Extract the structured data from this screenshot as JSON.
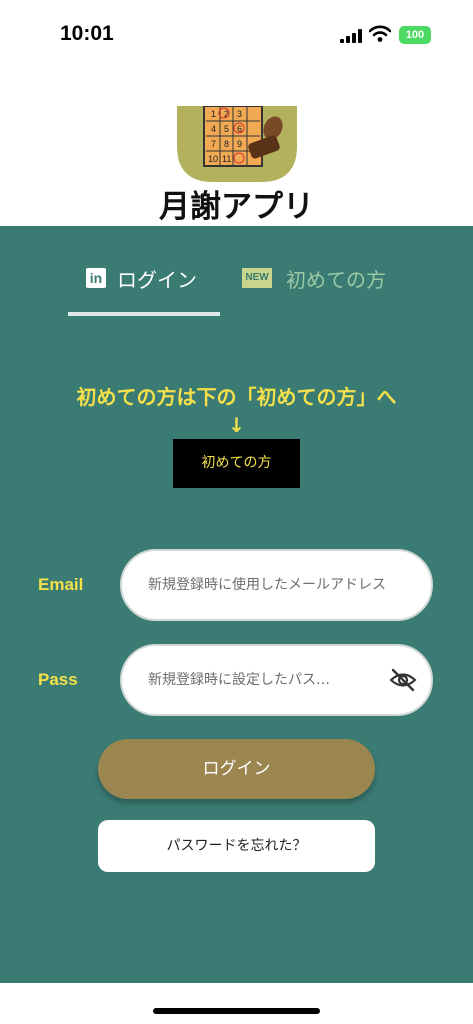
{
  "status": {
    "time": "10:01",
    "battery": "100"
  },
  "header": {
    "title": "月謝アプリ",
    "icon_numbers": [
      "1",
      "2",
      "3",
      "4",
      "5",
      "6",
      "7",
      "8",
      "9",
      "10",
      "11"
    ]
  },
  "tabs": [
    {
      "label": "ログイン",
      "icon": "linkedin-icon",
      "icon_text": "in",
      "active": true
    },
    {
      "label": "初めての方",
      "icon": "new-badge-icon",
      "icon_text": "NEW",
      "active": false
    }
  ],
  "notice": {
    "text": "初めての方は下の「初めての方」へ",
    "arrow": "↓"
  },
  "first_time_button": "初めての方",
  "form": {
    "email": {
      "label": "Email",
      "placeholder": "新規登録時に使用したメールアドレス"
    },
    "pass": {
      "label": "Pass",
      "placeholder": "新規登録時に設定したパス…"
    }
  },
  "login_button": "ログイン",
  "forgot_button": "パスワードを忘れた？",
  "colors": {
    "background": "#3a7b73",
    "accent_yellow": "#f3e04a",
    "login_button": "#9c8650",
    "tab_inactive": "#9bc9a7"
  }
}
